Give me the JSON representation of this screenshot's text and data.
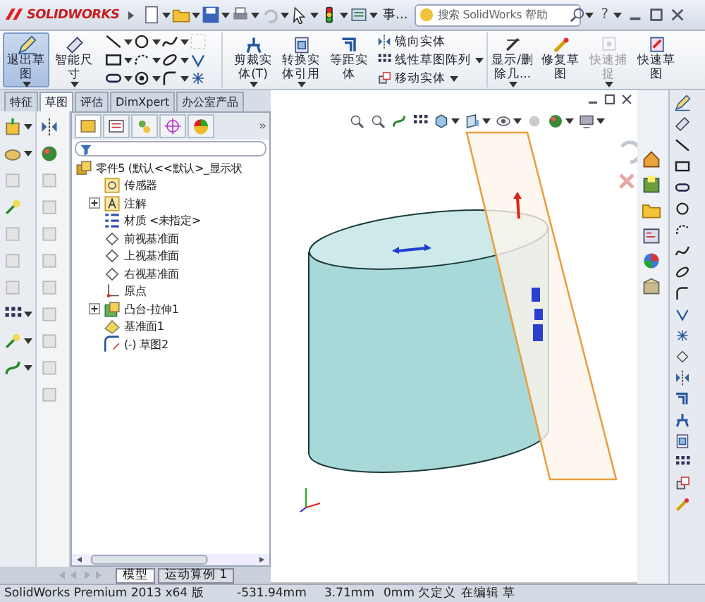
{
  "title_bar": {
    "logo": "SOLIDWORKS",
    "doc_label": "事...",
    "search": {
      "placeholder": "搜索 SolidWorks 帮助"
    },
    "help": "?"
  },
  "ribbon": {
    "items": [
      {
        "kind": "large",
        "label": "退出草图",
        "selected": true,
        "disabled": false,
        "has_menu": true
      },
      {
        "kind": "large",
        "label": "智能尺寸",
        "selected": false,
        "disabled": false,
        "has_menu": true
      },
      {
        "kind": "grid"
      },
      {
        "kind": "large",
        "label": "剪裁实体(T)",
        "selected": false,
        "disabled": false,
        "has_menu": true
      },
      {
        "kind": "large",
        "label": "转换实体引用",
        "selected": false,
        "disabled": false,
        "has_menu": true
      },
      {
        "kind": "large",
        "label": "等距实体",
        "selected": false,
        "disabled": false,
        "has_menu": false
      },
      {
        "kind": "stack",
        "entries": [
          "镜向实体",
          "线性草图阵列",
          "移动实体"
        ]
      },
      {
        "kind": "large",
        "label": "显示/删除几...",
        "selected": false,
        "disabled": false,
        "has_menu": true
      },
      {
        "kind": "large",
        "label": "修复草图",
        "selected": false,
        "disabled": false,
        "has_menu": false
      },
      {
        "kind": "large",
        "label": "快速捕捉",
        "selected": false,
        "disabled": true,
        "has_menu": true
      },
      {
        "kind": "large",
        "label": "快速草图",
        "selected": false,
        "disabled": false,
        "has_menu": false
      }
    ]
  },
  "command_tabs": [
    {
      "label": "特征",
      "selected": false
    },
    {
      "label": "草图",
      "selected": true
    },
    {
      "label": "评估",
      "selected": false
    },
    {
      "label": "DimXpert",
      "selected": false
    },
    {
      "label": "办公室产品",
      "selected": false
    }
  ],
  "feature_manager": {
    "more": "»",
    "tree": {
      "label": "零件5 (默认<<默认>_显示状",
      "kind": "part",
      "children": [
        {
          "label": "传感器",
          "kind": "sensor"
        },
        {
          "label": "注解",
          "kind": "annotation",
          "expanded": false
        },
        {
          "label": "材质 <未指定>",
          "kind": "material"
        },
        {
          "label": "前视基准面",
          "kind": "plane"
        },
        {
          "label": "上视基准面",
          "kind": "plane"
        },
        {
          "label": "右视基准面",
          "kind": "plane"
        },
        {
          "label": "原点",
          "kind": "origin"
        },
        {
          "label": "凸台-拉伸1",
          "kind": "feature",
          "expanded": false
        },
        {
          "label": "基准面1",
          "kind": "plane2"
        },
        {
          "label": "(-) 草图2",
          "kind": "sketch"
        }
      ]
    }
  },
  "bottom_tabs": [
    {
      "label": "模型",
      "selected": true
    },
    {
      "label": "运动算例 1",
      "selected": false
    }
  ],
  "status_bar": [
    "SolidWorks Premium 2013 x64 版",
    "-531.94mm",
    "3.71mm",
    "0mm 欠定义",
    "在编辑 草"
  ]
}
